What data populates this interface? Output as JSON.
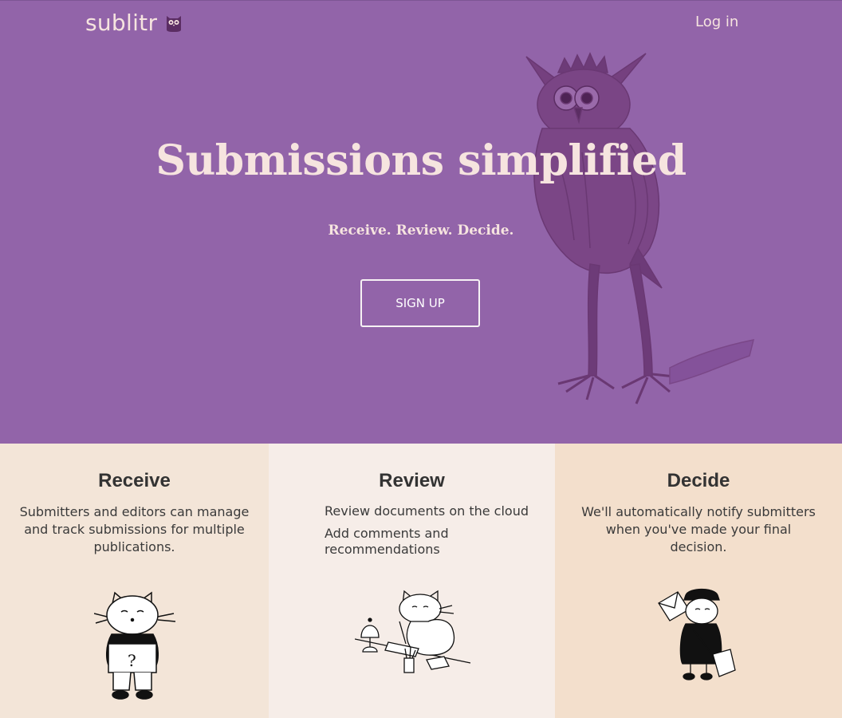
{
  "header": {
    "brand": "sublitr",
    "login_label": "Log in"
  },
  "hero": {
    "title": "Submissions simplified",
    "tagline": "Receive. Review. Decide.",
    "signup_label": "SIGN UP"
  },
  "features": [
    {
      "title": "Receive",
      "lines": [
        "Submitters and editors can manage and track submissions for multiple publications."
      ]
    },
    {
      "title": "Review",
      "lines": [
        "Review documents on the cloud",
        "Add comments and recommendations"
      ]
    },
    {
      "title": "Decide",
      "lines": [
        "We'll automatically notify submitters when you've made your final decision."
      ]
    }
  ],
  "colors": {
    "hero_bg": "#9264a9",
    "hero_text": "#f6e4df",
    "receive_bg": "#f3e5d8",
    "review_bg": "#f6ede8",
    "decide_bg": "#f3dfcc"
  },
  "icons": [
    "owl-logo-icon",
    "owl-illustration",
    "cat-box-illustration",
    "cat-writing-illustration",
    "cat-mail-carrier-illustration"
  ]
}
